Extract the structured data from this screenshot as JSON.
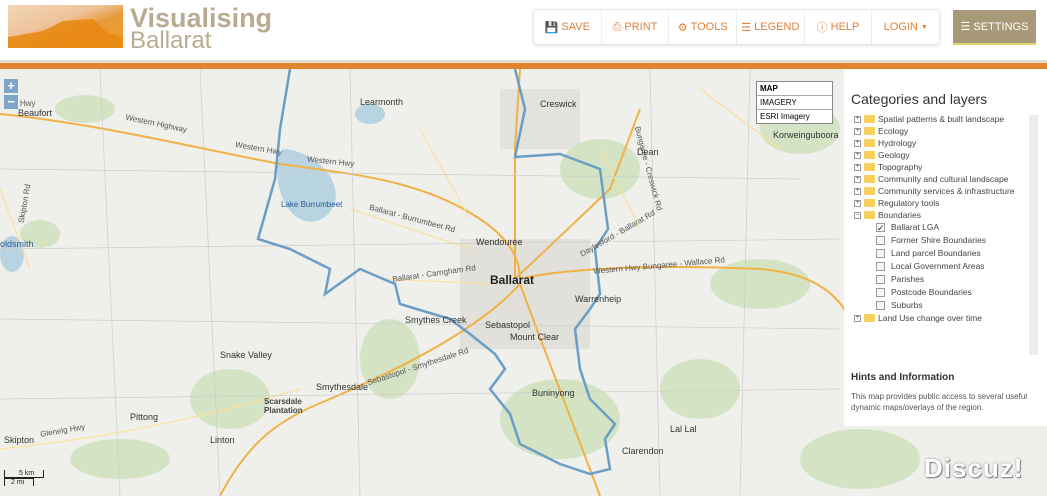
{
  "header": {
    "logo_line1": "Visualising",
    "logo_line2": "Ballarat"
  },
  "toolbar": {
    "save": "SAVE",
    "print": "PRINT",
    "tools": "TOOLS",
    "legend": "LEGEND",
    "help": "HELP",
    "login": "LOGIN",
    "settings": "SETTINGS"
  },
  "map": {
    "zoom_in": "+",
    "zoom_out": "−",
    "basemaps": [
      "MAP",
      "IMAGERY",
      "ESRI Imagery"
    ],
    "labels": [
      "Learmonth",
      "Creswick",
      "Beaufort",
      "Western Highway",
      "Western Hwy",
      "Western Hwy",
      "Dean",
      "Korweinguboora",
      "Lake Burrumbeet",
      "Skipton Rd",
      "Ballarat - Burrumbeet Rd",
      "Wendouree",
      "Ballarat",
      "Ballarat - Carngham Rd",
      "Western Hwy Bungaree - Wallace Rd",
      "Warrenheip",
      "Smythes Creek",
      "Sebastopol",
      "Mount Clear",
      "Snake Valley",
      "Smythesdale",
      "Sebastopol - Smythesdale Rd",
      "Buninyong",
      "Scarsdale Plantation",
      "Pittong",
      "Glenelg Hwy",
      "Linton",
      "Skipton",
      "Lal Lal",
      "Clarendon",
      "oldsmith",
      "Daylesford - Ballarat Rd",
      "Bungaree - Creswick Rd",
      "Hwy"
    ],
    "scale_km": "5 km",
    "scale_mi": "2 mi"
  },
  "panel": {
    "title": "Categories and layers",
    "categories": [
      "Spatial patterns & built landscape",
      "Ecology",
      "Hydrology",
      "Geology",
      "Topography",
      "Community and cultural landscape",
      "Community services & infrastructure",
      "Regulatory tools",
      "Boundaries"
    ],
    "boundary_layers": [
      {
        "label": "Ballarat LGA",
        "checked": true
      },
      {
        "label": "Former Shire Boundaries",
        "checked": false
      },
      {
        "label": "Land parcel Boundaries",
        "checked": false
      },
      {
        "label": "Local Government Areas",
        "checked": false
      },
      {
        "label": "Parishes",
        "checked": false
      },
      {
        "label": "Postcode Boundaries",
        "checked": false
      },
      {
        "label": "Suburbs",
        "checked": false
      }
    ],
    "last_category": "Land Use change over time",
    "hints_title": "Hints and Information",
    "hints_text": "This map provides public access to several useful dynamic maps/overlays of the region."
  },
  "watermark": "Discuz!"
}
